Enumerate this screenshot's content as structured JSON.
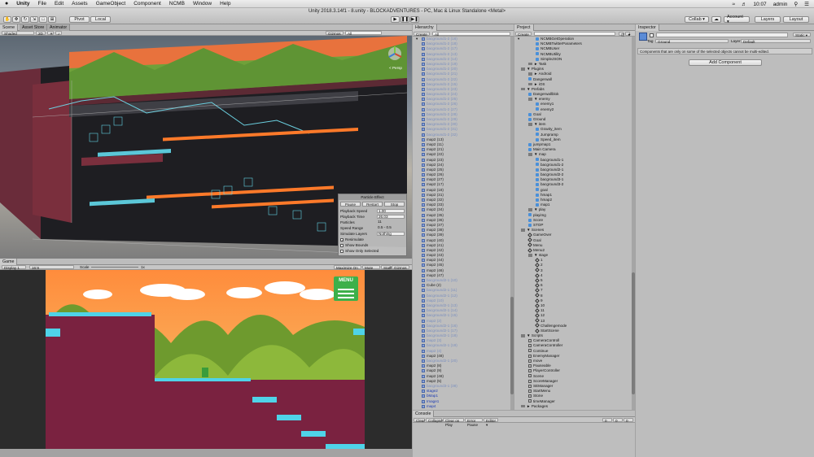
{
  "menubar": {
    "apple": "",
    "app": "Unity",
    "items": [
      "File",
      "Edit",
      "Assets",
      "GameObject",
      "Component",
      "NCMB",
      "Window",
      "Help"
    ],
    "time": "10:07",
    "user": "admin"
  },
  "window_title": "Unity 2018.3.14f1 - 8.unity - BLOCKADVENTURES - PC, Mac & Linux Standalone <Metal>",
  "toolbar": {
    "pivot": "Pivot",
    "local": "Local",
    "collab": "Collab ▾",
    "account": "Account ▾",
    "layers": "Layers",
    "layout": "Layout"
  },
  "scene": {
    "tabs": [
      "Scene",
      "Asset Store",
      "Animator"
    ],
    "shading": "Shaded",
    "mode2d": "2D",
    "gizmos": "Gizmos ▾",
    "search_placeholder": "All",
    "persp": "< Persp"
  },
  "particle": {
    "title": "Particle Effect",
    "buttons": [
      "Pause",
      "Restart",
      "Stop"
    ],
    "props": [
      [
        "Playback Speed",
        "1.00"
      ],
      [
        "Playback Time",
        "26.03"
      ],
      [
        "Particles",
        "11"
      ],
      [
        "Speed Range",
        "0.5 - 0.5"
      ],
      [
        "Simulate Layers",
        "Nothing"
      ]
    ],
    "checks": [
      [
        "Resimulate",
        "✓"
      ],
      [
        "Show Bounds",
        ""
      ],
      [
        "Show Only Selected",
        ""
      ]
    ]
  },
  "game": {
    "tab": "Game",
    "display": "Display 1",
    "aspect": "16:9",
    "scale_label": "Scale",
    "scale_value": "1x",
    "buttons": [
      "Maximize On Play",
      "Mute Audio",
      "Stats",
      "Gizmos ▾"
    ],
    "menu_label": "MENU"
  },
  "hierarchy": {
    "tab": "Hierarchy",
    "create": "Create ▾",
    "search_placeholder": "All",
    "rows": [
      {
        "t": "bacground1-2 (16)",
        "c": "dim"
      },
      {
        "t": "bacground1-2 (18)",
        "c": "dim"
      },
      {
        "t": "bacground1-2 (17)",
        "c": "dim"
      },
      {
        "t": "bacground1-2 (13)",
        "c": "dim"
      },
      {
        "t": "bacground1-2 (14)",
        "c": "dim"
      },
      {
        "t": "bacground1-2 (19)",
        "c": "dim"
      },
      {
        "t": "bacground1-2 (20)",
        "c": "dim"
      },
      {
        "t": "bacground1-2 (21)",
        "c": "dim"
      },
      {
        "t": "bacground1-2 (22)",
        "c": "dim"
      },
      {
        "t": "bacground1-2 (15)",
        "c": "dim"
      },
      {
        "t": "bacground1-2 (23)",
        "c": "dim"
      },
      {
        "t": "bacground1-2 (24)",
        "c": "dim"
      },
      {
        "t": "bacground1-2 (25)",
        "c": "dim"
      },
      {
        "t": "bacground1-2 (26)",
        "c": "dim"
      },
      {
        "t": "bacground1-2 (27)",
        "c": "dim"
      },
      {
        "t": "bacground1-2 (28)",
        "c": "dim"
      },
      {
        "t": "bacground1-2 (29)",
        "c": "dim"
      },
      {
        "t": "bacground1-2 (30)",
        "c": "dim"
      },
      {
        "t": "bacground1-2 (31)",
        "c": "dim"
      },
      {
        "t": "bacground1-2 (32)",
        "c": "dim"
      },
      {
        "t": "map2 (13)",
        "c": ""
      },
      {
        "t": "map2 (11)",
        "c": ""
      },
      {
        "t": "map2 (21)",
        "c": ""
      },
      {
        "t": "map2 (22)",
        "c": ""
      },
      {
        "t": "map2 (23)",
        "c": ""
      },
      {
        "t": "map2 (24)",
        "c": ""
      },
      {
        "t": "map2 (25)",
        "c": ""
      },
      {
        "t": "map2 (26)",
        "c": ""
      },
      {
        "t": "map2 (27)",
        "c": ""
      },
      {
        "t": "map2 (17)",
        "c": ""
      },
      {
        "t": "map2 (18)",
        "c": ""
      },
      {
        "t": "map2 (31)",
        "c": ""
      },
      {
        "t": "map2 (32)",
        "c": ""
      },
      {
        "t": "map2 (33)",
        "c": ""
      },
      {
        "t": "map2 (34)",
        "c": ""
      },
      {
        "t": "map2 (35)",
        "c": ""
      },
      {
        "t": "map2 (36)",
        "c": ""
      },
      {
        "t": "map2 (37)",
        "c": ""
      },
      {
        "t": "map2 (38)",
        "c": ""
      },
      {
        "t": "map2 (39)",
        "c": ""
      },
      {
        "t": "map2 (40)",
        "c": ""
      },
      {
        "t": "map2 (41)",
        "c": ""
      },
      {
        "t": "map2 (42)",
        "c": ""
      },
      {
        "t": "map2 (43)",
        "c": ""
      },
      {
        "t": "map2 (44)",
        "c": ""
      },
      {
        "t": "map2 (45)",
        "c": ""
      },
      {
        "t": "map2 (46)",
        "c": ""
      },
      {
        "t": "map2 (47)",
        "c": ""
      },
      {
        "t": "bacground2-1 (10)",
        "c": "dim"
      },
      {
        "t": "Cube (2)",
        "c": ""
      },
      {
        "t": "bacground2-1 (11)",
        "c": "dim"
      },
      {
        "t": "bacground2-1 (12)",
        "c": "dim"
      },
      {
        "t": "map2 (10)",
        "c": "dim"
      },
      {
        "t": "bacground2-1 (13)",
        "c": "dim"
      },
      {
        "t": "bacground2-1 (14)",
        "c": "dim"
      },
      {
        "t": "bacground2-1 (15)",
        "c": "dim"
      },
      {
        "t": "map2 (2)",
        "c": "dim"
      },
      {
        "t": "bacground2-1 (16)",
        "c": "dim"
      },
      {
        "t": "bacground2-1 (17)",
        "c": "dim"
      },
      {
        "t": "bacground2-1 (18)",
        "c": "dim"
      },
      {
        "t": "map2 (3)",
        "c": "dim"
      },
      {
        "t": "bacground2-1 (19)",
        "c": "dim"
      },
      {
        "t": "map2 (4)",
        "c": "dim"
      },
      {
        "t": "map2 (48)",
        "c": ""
      },
      {
        "t": "bacground2-1 (20)",
        "c": "dim"
      },
      {
        "t": "map2 (8)",
        "c": ""
      },
      {
        "t": "map2 (9)",
        "c": ""
      },
      {
        "t": "map2 (48)",
        "c": ""
      },
      {
        "t": "map2 (5)",
        "c": ""
      },
      {
        "t": "bacground3-1 (38)",
        "c": "dim"
      },
      {
        "t": "stage2",
        "c": "prefab"
      },
      {
        "t": "bMap1",
        "c": "prefab"
      },
      {
        "t": "Image1",
        "c": "prefab"
      },
      {
        "t": "map4",
        "c": "prefab"
      },
      {
        "t": "tree",
        "c": "dim"
      }
    ]
  },
  "project": {
    "tab": "Project",
    "create": "Create ▾",
    "rows": [
      {
        "d": 2,
        "i": "a",
        "t": "NCMBGetOperation"
      },
      {
        "d": 2,
        "i": "a",
        "t": "NCMBTwitterParameters"
      },
      {
        "d": 2,
        "i": "a",
        "t": "NCMBUser"
      },
      {
        "d": 2,
        "i": "a",
        "t": "NCMBUtility"
      },
      {
        "d": 2,
        "i": "a",
        "t": "SimpleJSON"
      },
      {
        "d": 1,
        "i": "f",
        "t": "► Task"
      },
      {
        "d": 0,
        "i": "f",
        "t": "▼ Plugins"
      },
      {
        "d": 1,
        "i": "f",
        "t": "► Android"
      },
      {
        "d": 1,
        "i": "a",
        "t": "Dangerwall"
      },
      {
        "d": 1,
        "i": "f",
        "t": "► iOS"
      },
      {
        "d": 0,
        "i": "f",
        "t": "▼ Prefabs"
      },
      {
        "d": 1,
        "i": "a",
        "t": "Dangerwallblok"
      },
      {
        "d": 1,
        "i": "f",
        "t": "▼ enemy"
      },
      {
        "d": 2,
        "i": "a",
        "t": "enemy1"
      },
      {
        "d": 2,
        "i": "a",
        "t": "enemy2"
      },
      {
        "d": 1,
        "i": "a",
        "t": "Goal"
      },
      {
        "d": 1,
        "i": "a",
        "t": "Ground"
      },
      {
        "d": 1,
        "i": "f",
        "t": "▼ item"
      },
      {
        "d": 2,
        "i": "a",
        "t": "Gravity_item"
      },
      {
        "d": 2,
        "i": "a",
        "t": "Jumpramp"
      },
      {
        "d": 2,
        "i": "a",
        "t": "Speed_item"
      },
      {
        "d": 1,
        "i": "a",
        "t": "jumpmap1"
      },
      {
        "d": 1,
        "i": "a",
        "t": "Main Camera"
      },
      {
        "d": 1,
        "i": "f",
        "t": "▼ map"
      },
      {
        "d": 2,
        "i": "a",
        "t": "bacground1-1"
      },
      {
        "d": 2,
        "i": "a",
        "t": "bacground1-2"
      },
      {
        "d": 2,
        "i": "a",
        "t": "bacground2-1"
      },
      {
        "d": 2,
        "i": "a",
        "t": "bacground2-2"
      },
      {
        "d": 2,
        "i": "a",
        "t": "bacground3-1"
      },
      {
        "d": 2,
        "i": "a",
        "t": "bacground3-2"
      },
      {
        "d": 2,
        "i": "a",
        "t": "goal"
      },
      {
        "d": 2,
        "i": "a",
        "t": "hmap1"
      },
      {
        "d": 2,
        "i": "a",
        "t": "hmap2"
      },
      {
        "d": 2,
        "i": "a",
        "t": "map1"
      },
      {
        "d": 1,
        "i": "f",
        "t": "▼ play"
      },
      {
        "d": 1,
        "i": "a",
        "t": "playimg"
      },
      {
        "d": 1,
        "i": "a",
        "t": "Score"
      },
      {
        "d": 1,
        "i": "a",
        "t": "STOP"
      },
      {
        "d": 0,
        "i": "f",
        "t": "▼ Scenes"
      },
      {
        "d": 1,
        "i": "u",
        "t": "GameOver"
      },
      {
        "d": 1,
        "i": "u",
        "t": "Goal"
      },
      {
        "d": 1,
        "i": "u",
        "t": "Menu"
      },
      {
        "d": 1,
        "i": "u",
        "t": "Menu2"
      },
      {
        "d": 1,
        "i": "f",
        "t": "▼ stage"
      },
      {
        "d": 2,
        "i": "u",
        "t": "1"
      },
      {
        "d": 2,
        "i": "u",
        "t": "2"
      },
      {
        "d": 2,
        "i": "u",
        "t": "3"
      },
      {
        "d": 2,
        "i": "u",
        "t": "4"
      },
      {
        "d": 2,
        "i": "u",
        "t": "5"
      },
      {
        "d": 2,
        "i": "u",
        "t": "6"
      },
      {
        "d": 2,
        "i": "u",
        "t": "7"
      },
      {
        "d": 2,
        "i": "u",
        "t": "8"
      },
      {
        "d": 2,
        "i": "u",
        "t": "9"
      },
      {
        "d": 2,
        "i": "u",
        "t": "10"
      },
      {
        "d": 2,
        "i": "u",
        "t": "11"
      },
      {
        "d": 2,
        "i": "u",
        "t": "12"
      },
      {
        "d": 2,
        "i": "u",
        "t": "13"
      },
      {
        "d": 2,
        "i": "u",
        "t": "Challengemode"
      },
      {
        "d": 2,
        "i": "u",
        "t": "StartScene"
      },
      {
        "d": 0,
        "i": "f",
        "t": "▼ Scripts"
      },
      {
        "d": 1,
        "i": "s",
        "t": "CameraControll"
      },
      {
        "d": 1,
        "i": "s",
        "t": "CameraController"
      },
      {
        "d": 1,
        "i": "s",
        "t": "Continue"
      },
      {
        "d": 1,
        "i": "s",
        "t": "EnemyManager"
      },
      {
        "d": 1,
        "i": "s",
        "t": "move"
      },
      {
        "d": 1,
        "i": "s",
        "t": "Pauseable"
      },
      {
        "d": 1,
        "i": "s",
        "t": "PlayerController"
      },
      {
        "d": 1,
        "i": "s",
        "t": "Scene"
      },
      {
        "d": 1,
        "i": "s",
        "t": "ScoreManager"
      },
      {
        "d": 1,
        "i": "s",
        "t": "SEManager"
      },
      {
        "d": 1,
        "i": "s",
        "t": "StartMenu"
      },
      {
        "d": 1,
        "i": "s",
        "t": "Stone"
      },
      {
        "d": 1,
        "i": "s",
        "t": "timeManager"
      },
      {
        "d": 0,
        "i": "f",
        "t": "► Packages"
      }
    ]
  },
  "console": {
    "tab": "Console",
    "buttons": [
      "Clear",
      "Collapse",
      "Clear on Play",
      "Error Pause",
      "Editor ▾"
    ],
    "counts": [
      "0",
      "0",
      "0"
    ]
  },
  "inspector": {
    "tab": "Inspector",
    "static": "Static ▾",
    "tag_label": "Tag",
    "tag_value": "Ground",
    "layer_label": "Layer",
    "layer_value": "Default",
    "note": "Components that are only on some of the selected objects cannot be multi-edited.",
    "add_component": "Add Component"
  }
}
